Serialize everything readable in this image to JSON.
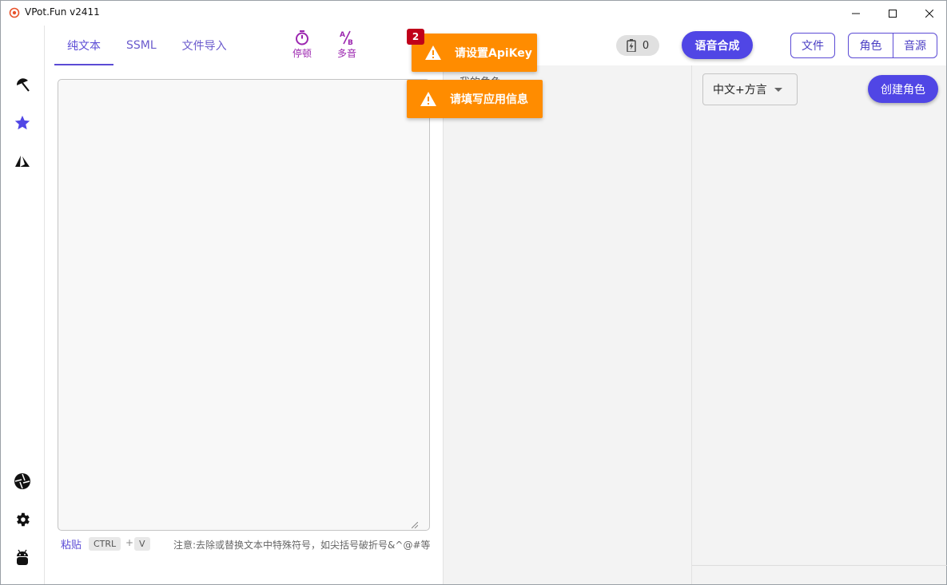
{
  "window": {
    "title": "VPot.Fun v2411"
  },
  "tabs": [
    {
      "label": "纯文本",
      "active": true
    },
    {
      "label": "SSML",
      "active": false
    },
    {
      "label": "文件导入",
      "active": false
    }
  ],
  "tools": {
    "pause_label": "停顿",
    "polyphone_label": "多音"
  },
  "counter": {
    "value": "0"
  },
  "header": {
    "synth_label": "语音合成",
    "file_label": "文件",
    "role_label": "角色",
    "source_label": "音源"
  },
  "editor": {
    "text": "",
    "paste_label": "粘贴",
    "ctrl_key": "CTRL",
    "plus": "+",
    "v_key": "V",
    "note": "注意:去除或替换文本中特殊符号，如尖括号破折号&^@#等"
  },
  "mid_panel": {
    "label": "我的角色"
  },
  "right_panel": {
    "language_select": "中文+方言",
    "create_role_label": "创建角色"
  },
  "toasts": {
    "count": "2",
    "items": [
      "请设置ApiKey",
      "请填写应用信息"
    ]
  },
  "colors": {
    "accent": "#5046e5",
    "warning": "#ff8c00",
    "badge": "#c0001a",
    "tool": "#9c27b0"
  }
}
